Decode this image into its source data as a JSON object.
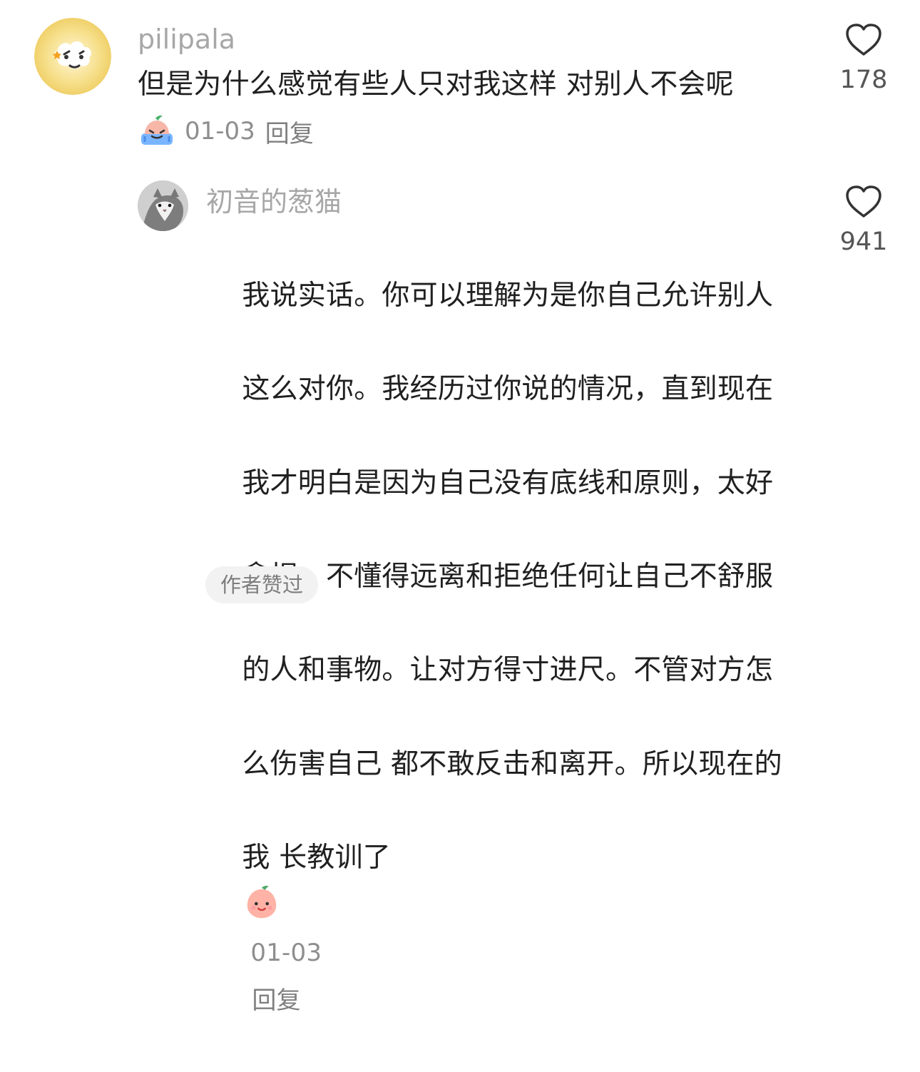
{
  "comments": [
    {
      "author": "pilipala",
      "text": "但是为什么感觉有些人只对我这样 对别人不会呢",
      "date": "01-03",
      "reply_label": "回复",
      "likes": "178",
      "avatar_icon": "cartoon-cloud-avatar-icon",
      "emoji_icon": "crying-sticker-icon"
    },
    {
      "author": "初音的葱猫",
      "text_lines": [
        "我说实话。你可以理解为是你自己允许别人",
        "这么对你。我经历过你说的情况，直到现在",
        "我才明白是因为自己没有底线和原则，太好",
        "拿捏，不懂得远离和拒绝任何让自己不舒服",
        "的人和事物。让对方得寸进尺。不管对方怎",
        "么伤害自己 都不敢反击和离开。所以现在的",
        "我 长教训了"
      ],
      "date": "01-03",
      "reply_label": "回复",
      "likes": "941",
      "avatar_icon": "cat-photo-avatar-icon",
      "emoji_icon": "smiling-peach-sticker-icon",
      "badge": "作者赞过"
    }
  ],
  "icons": {
    "like": "heart-outline-icon"
  },
  "colors": {
    "author_text": "#a7a7a7",
    "body_text": "#202020",
    "meta_text": "#8e8e8e",
    "badge_bg": "#f2f2f2"
  }
}
